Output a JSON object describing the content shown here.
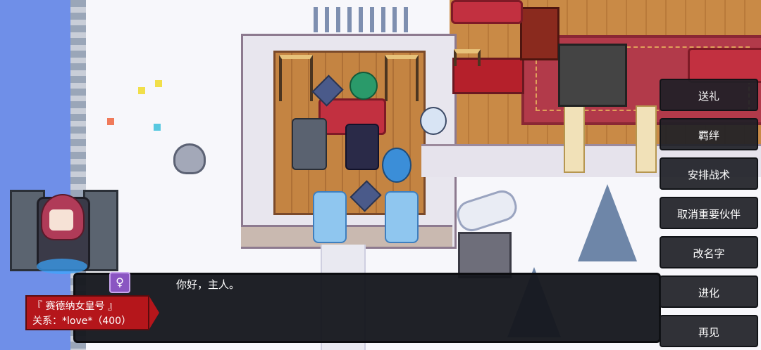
{
  "dialog": {
    "message": "你好，主人。",
    "gender_symbol": "♀",
    "character_name": "『 赛德纳女皇号 』",
    "relation": "关系：*love*（400）"
  },
  "menu": {
    "items": [
      {
        "label": "送礼"
      },
      {
        "label": "羁绊"
      },
      {
        "label": "安排战术"
      },
      {
        "label": "取消重要伙伴"
      },
      {
        "label": "改名字"
      },
      {
        "label": "进化"
      },
      {
        "label": "再见"
      }
    ]
  },
  "colors": {
    "nameplate": "#b5161b",
    "dialog_bg": "#16181e",
    "gender_badge": "#8a55c2"
  }
}
